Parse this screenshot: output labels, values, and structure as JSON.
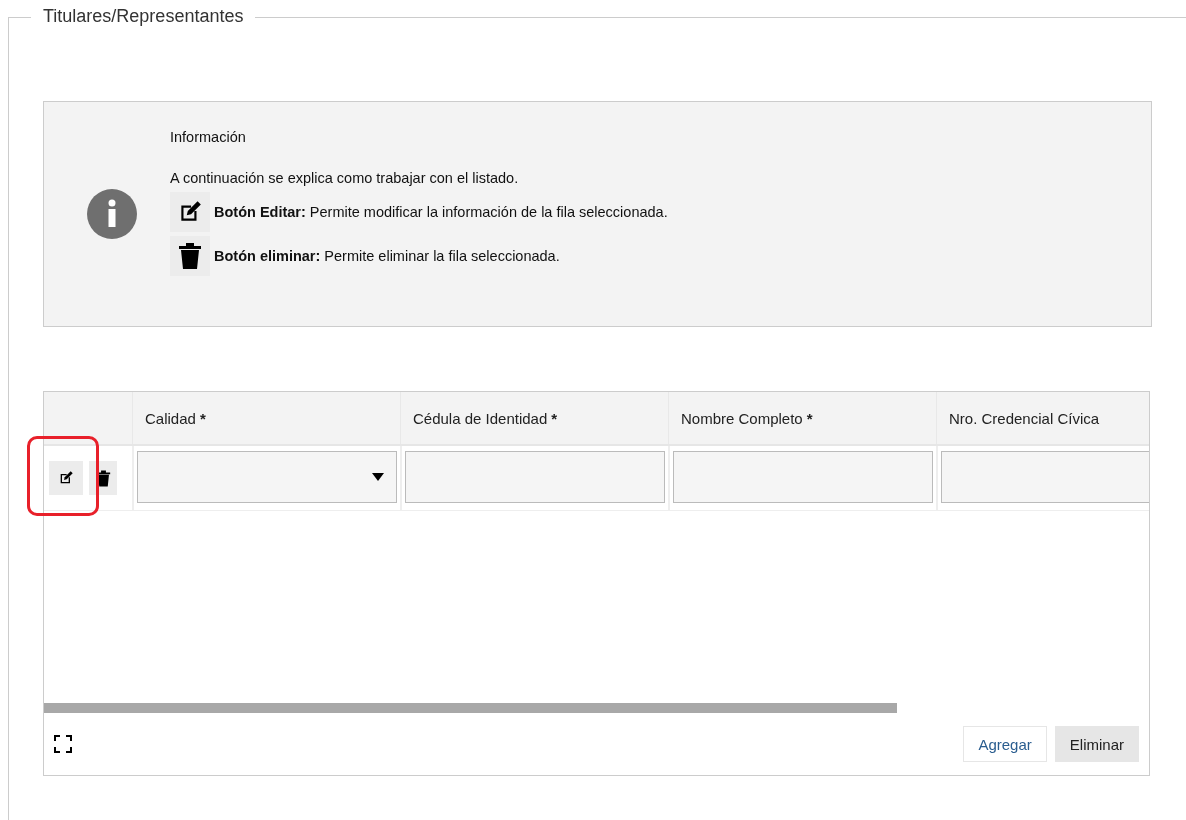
{
  "section": {
    "legend": "Titulares/Representantes"
  },
  "info": {
    "title": "Información",
    "intro": "A continuación se explica como trabajar con el listado.",
    "items": [
      {
        "kind": "edit",
        "text": "**Botón Editar:** Permite modificar la información de la fila seleccionada."
      },
      {
        "kind": "delete",
        "text": "**Botón eliminar:** Permite eliminar la fila seleccionada."
      }
    ]
  },
  "grid": {
    "columns": [
      {
        "label": "Calidad",
        "required_mark": "*",
        "kind": "select"
      },
      {
        "label": "Cédula de Identidad",
        "required_mark": "*",
        "kind": "text"
      },
      {
        "label": "Nombre Completo",
        "required_mark": "*",
        "kind": "text"
      },
      {
        "label": "Nro. Credencial Cívica",
        "kind": "text"
      }
    ],
    "row": {
      "edit_highlighted": true
    },
    "buttons": [
      {
        "label": "Agregar",
        "kind": "link"
      },
      {
        "label": "Eliminar",
        "kind": "filled"
      }
    ]
  }
}
